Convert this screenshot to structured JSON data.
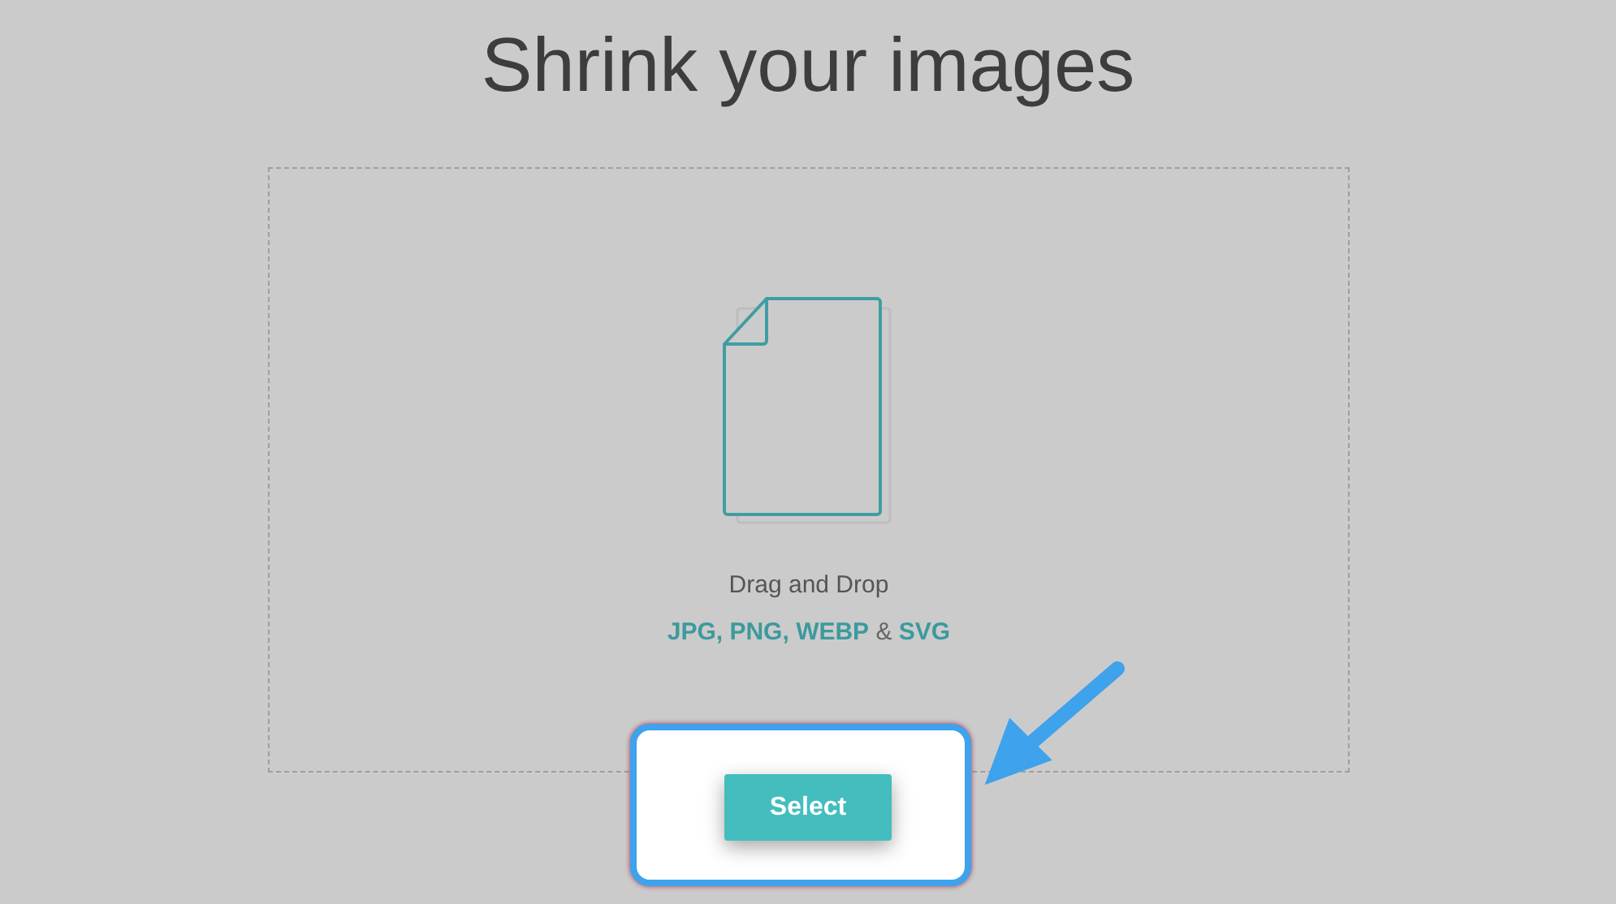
{
  "title": "Shrink your images",
  "dropzone": {
    "hint": "Drag and Drop",
    "formats": "**JPG, PNG, WEBP** & **SVG**"
  },
  "button": {
    "label": "Select"
  }
}
